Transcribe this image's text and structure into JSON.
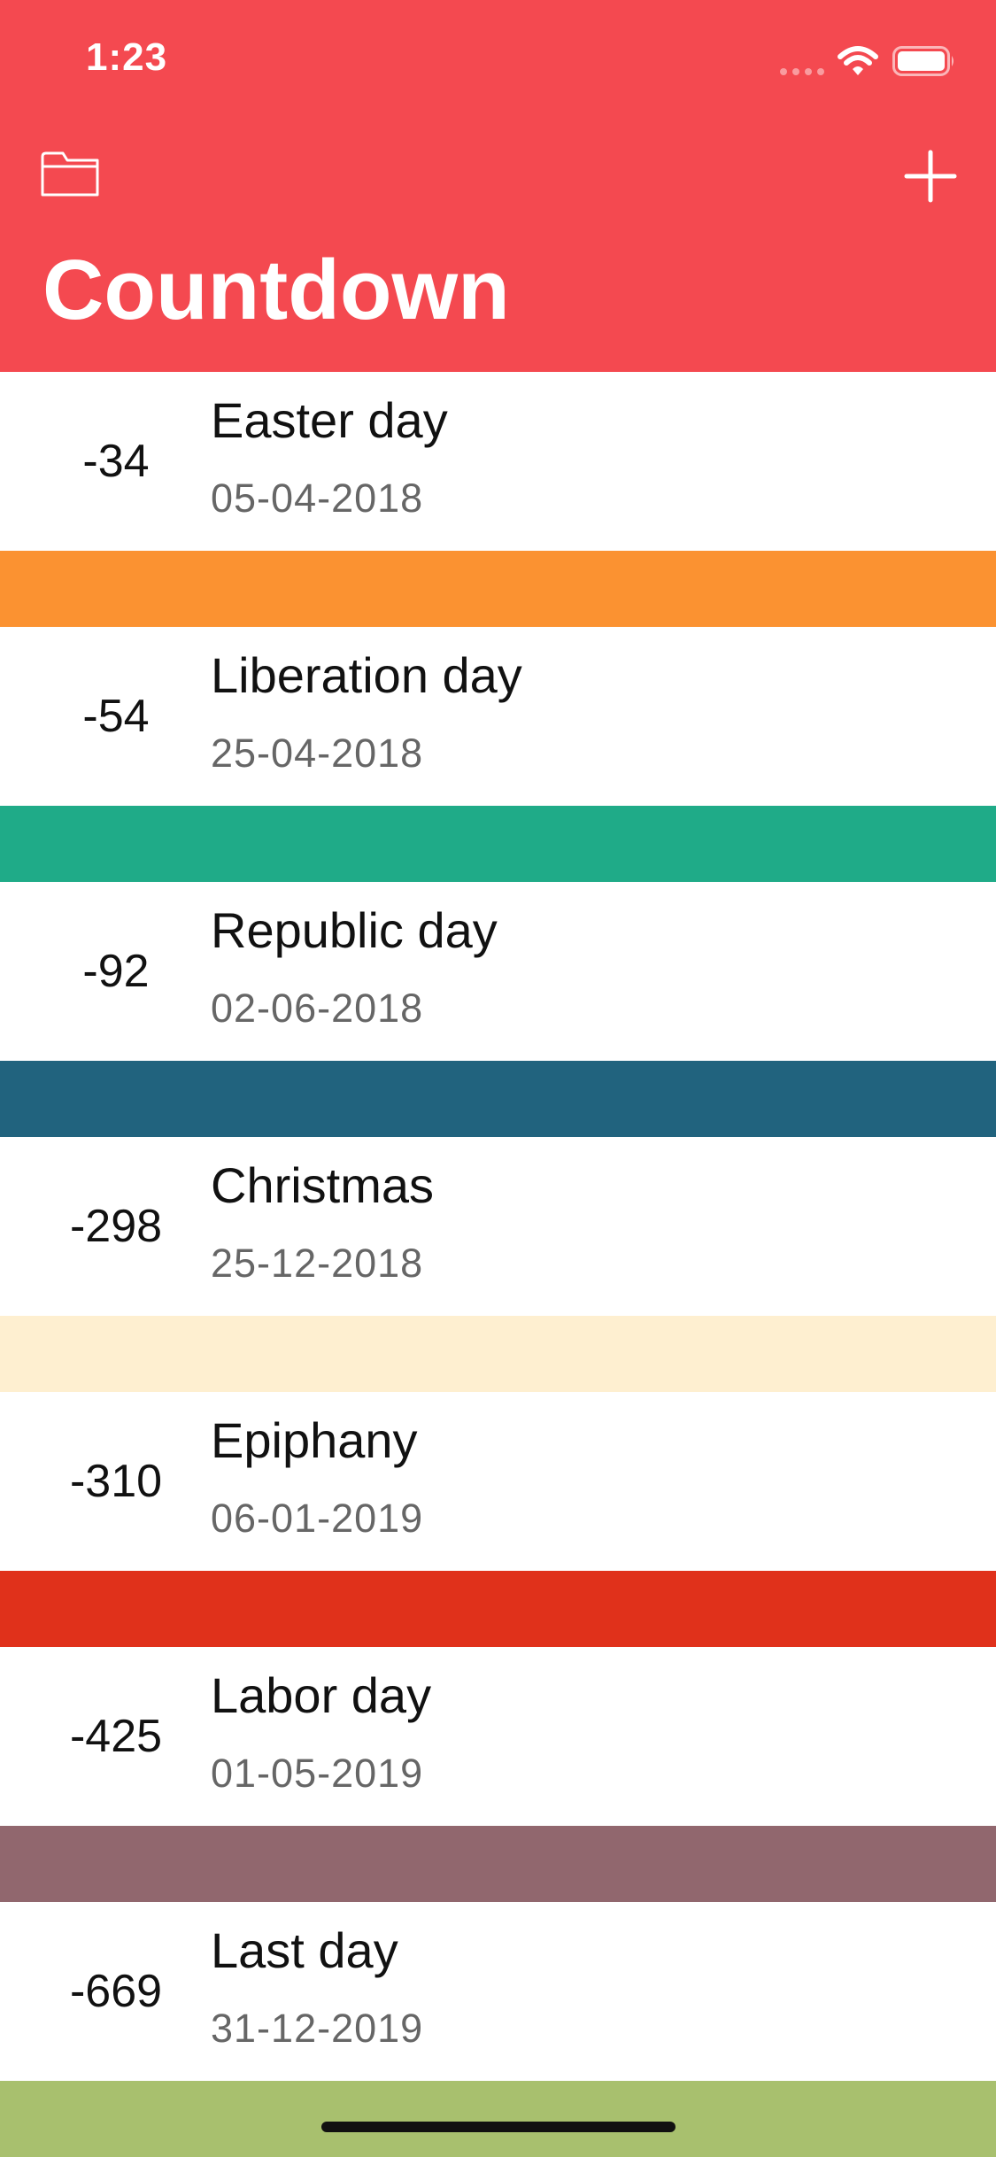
{
  "status_bar": {
    "time": "1:23"
  },
  "header": {
    "title": "Countdown",
    "accent_color": "#F44950"
  },
  "events": [
    {
      "days": "-34",
      "name": "Easter day",
      "date": "05-04-2018",
      "color": "#FB9231"
    },
    {
      "days": "-54",
      "name": "Liberation day",
      "date": "25-04-2018",
      "color": "#1FAB88"
    },
    {
      "days": "-92",
      "name": "Republic day",
      "date": "02-06-2018",
      "color": "#21637E"
    },
    {
      "days": "-298",
      "name": "Christmas",
      "date": "25-12-2018",
      "color": "#FEEFD0"
    },
    {
      "days": "-310",
      "name": "Epiphany",
      "date": "06-01-2019",
      "color": "#E0311B"
    },
    {
      "days": "-425",
      "name": "Labor day",
      "date": "01-05-2019",
      "color": "#91676E"
    },
    {
      "days": "-669",
      "name": "Last day",
      "date": "31-12-2019",
      "color": "#A8C06E"
    }
  ]
}
